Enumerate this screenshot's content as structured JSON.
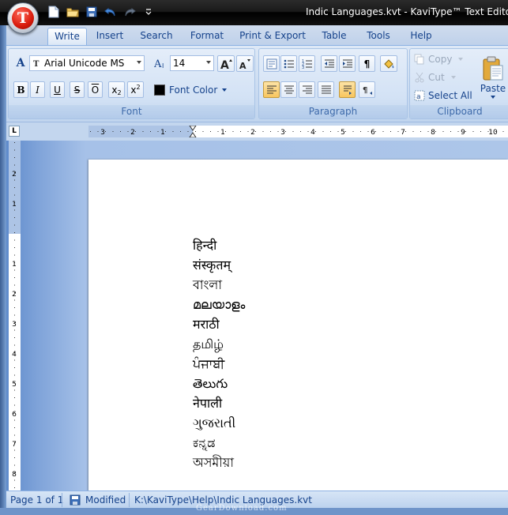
{
  "window": {
    "title": "Indic Languages.kvt - KaviType™ Text Editor",
    "app_logo_letter": "T"
  },
  "qat": {
    "icons": [
      "new-document-icon",
      "open-folder-icon",
      "save-icon",
      "undo-icon",
      "redo-icon",
      "customize-qat-icon"
    ]
  },
  "tabs": [
    {
      "label": "Write",
      "active": true
    },
    {
      "label": "Insert",
      "active": false
    },
    {
      "label": "Search",
      "active": false
    },
    {
      "label": "Format",
      "active": false
    },
    {
      "label": "Print & Export",
      "active": false
    },
    {
      "label": "Table",
      "active": false
    },
    {
      "label": "Tools",
      "active": false
    },
    {
      "label": "Help",
      "active": false
    }
  ],
  "font_group": {
    "label": "Font",
    "font_name": "Arial Unicode MS",
    "font_size": "14",
    "bold": "B",
    "italic": "I",
    "underline": "U",
    "strikethrough": "S",
    "overline": "O",
    "subscript": "x",
    "subscript_mark": "2",
    "superscript": "x",
    "superscript_mark": "2",
    "font_color_label": "Font Color",
    "font_color_value": "#000000"
  },
  "paragraph_group": {
    "label": "Paragraph",
    "pilcrow": "¶"
  },
  "clipboard_group": {
    "label": "Clipboard",
    "copy": "Copy",
    "cut": "Cut",
    "select_all": "Select All",
    "paste": "Paste"
  },
  "ruler": {
    "corner": "L",
    "h_ticks": [
      "3",
      "2",
      "1",
      "1",
      "2",
      "3",
      "4",
      "5",
      "6",
      "7",
      "8",
      "9",
      "10"
    ],
    "v_ticks": [
      "2",
      "1",
      "1",
      "2",
      "3",
      "4",
      "5",
      "6",
      "7",
      "8"
    ]
  },
  "document": {
    "lines": [
      "हिन्दी",
      "संस्कृतम्",
      "বাংলা",
      "മലയാളം",
      "मराठी",
      "தமிழ்",
      "ਪੰਜਾਬੀ",
      "తెలుగు",
      "नेपाली",
      "ગુજરાતી",
      "ಕನ್ನಡ",
      "অসমীয়া"
    ]
  },
  "status": {
    "page": "Page 1 of 1",
    "modified": "Modified",
    "path": "K:\\KaviType\\Help\\Indic Languages.kvt"
  },
  "watermark": "GearDownload.com",
  "colors": {
    "accent": "#15428b",
    "title_bar": "#000000",
    "ribbon": "#c7d9f0",
    "highlight": "#f8c65f"
  }
}
